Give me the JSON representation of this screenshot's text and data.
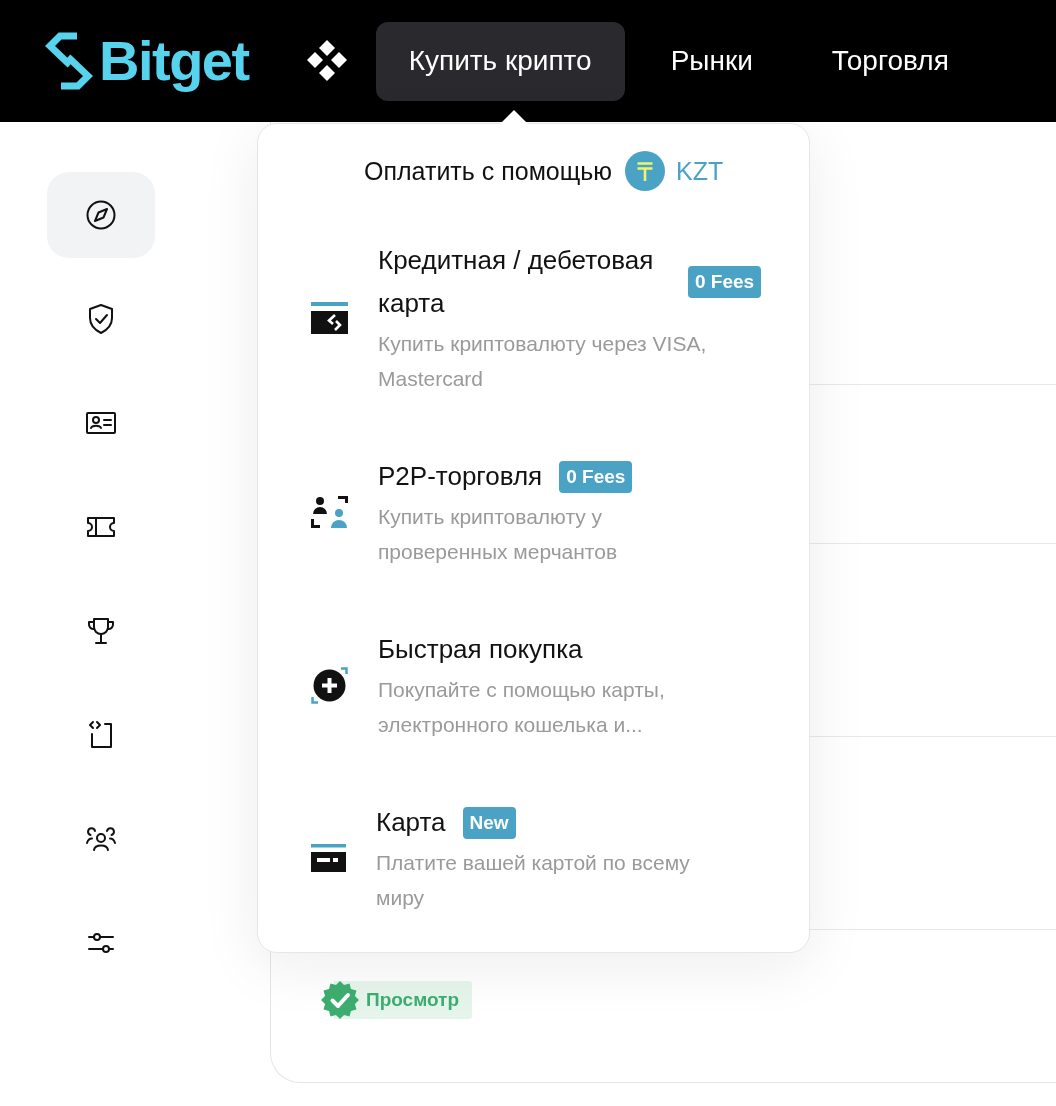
{
  "header": {
    "logo": "Bitget",
    "nav": [
      {
        "label": "Купить крипто",
        "selected": true
      },
      {
        "label": "Рынки",
        "selected": false
      },
      {
        "label": "Торговля",
        "selected": false
      }
    ]
  },
  "sidebar": {
    "items": [
      {
        "selected": true
      },
      {
        "selected": false
      },
      {
        "selected": false
      },
      {
        "selected": false
      },
      {
        "selected": false
      },
      {
        "selected": false
      },
      {
        "selected": false
      },
      {
        "selected": false
      }
    ]
  },
  "buy_menu": {
    "pay_with": {
      "label": "Оплатить с помощью",
      "currency": "KZT"
    },
    "options": [
      {
        "title": "Кредитная / дебетовая карта",
        "badge": "0 Fees",
        "description": "Купить криптовалюту через VISA, Mastercard"
      },
      {
        "title": "P2P-торговля",
        "badge": "0 Fees",
        "description": "Купить криптовалюту у проверенных мерчантов"
      },
      {
        "title": "Быстрая покупка",
        "description": "Покупайте с помощью карты, электронного кошелька и..."
      },
      {
        "title": "Карта",
        "badge": "New",
        "description": "Платите вашей картой по всему миру"
      }
    ]
  },
  "content": {
    "status_badge": "Просмотр"
  }
}
